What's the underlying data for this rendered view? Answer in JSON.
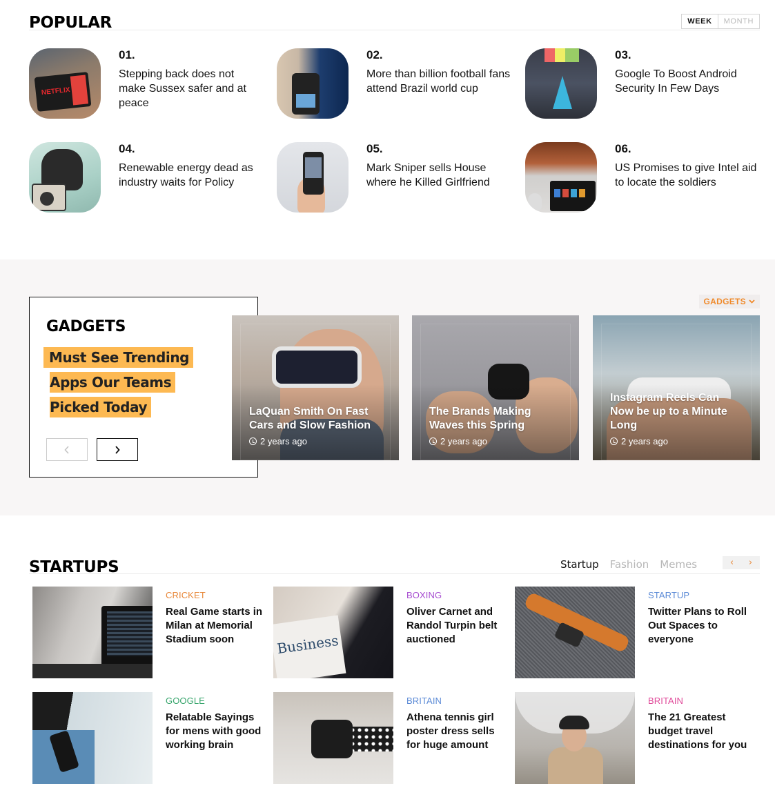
{
  "popular": {
    "title": "POPULAR",
    "period_tabs": [
      {
        "label": "WEEK",
        "active": true
      },
      {
        "label": "MONTH",
        "active": false
      }
    ],
    "items": [
      {
        "number": "01.",
        "title": "Stepping back does not make Sussex safer and at peace",
        "image": "tablet-netflix"
      },
      {
        "number": "02.",
        "title": "More than billion football fans attend Brazil world cup",
        "image": "payment-terminal"
      },
      {
        "number": "03.",
        "title": "Google To Boost Android Security In Few Days",
        "image": "blue-lamp"
      },
      {
        "number": "04.",
        "title": "Renewable energy dead as industry waits for Policy",
        "image": "radio-person"
      },
      {
        "number": "05.",
        "title": "Mark Sniper sells House where he Killed Girlfriend",
        "image": "hand-phone"
      },
      {
        "number": "06.",
        "title": "US Promises to give Intel aid to locate the soldiers",
        "image": "tv-speaker"
      }
    ]
  },
  "gadgets": {
    "title": "GADGETS",
    "highlight_lines": [
      "Must See Trending",
      "Apps Our Teams",
      "Picked Today"
    ],
    "prev_icon": "chevron-left-icon",
    "next_icon": "chevron-right-icon",
    "filter": {
      "label": "GADGETS",
      "icon": "chevron-down-icon",
      "color": "#f08a2b"
    },
    "highlight_color": "#fdb952",
    "cards": [
      {
        "title": "LaQuan Smith On Fast Cars and Slow Fashion",
        "time": "2 years ago",
        "image": "vr-headset"
      },
      {
        "title": "The Brands Making Waves this Spring",
        "time": "2 years ago",
        "image": "earbuds"
      },
      {
        "title": "Instagram Reels Can Now be up to a Minute Long",
        "time": "2 years ago",
        "image": "game-controller"
      }
    ]
  },
  "startups": {
    "title": "STARTUPS",
    "tabs": [
      {
        "label": "Startup",
        "active": true
      },
      {
        "label": "Fashion",
        "active": false
      },
      {
        "label": "Memes",
        "active": false
      }
    ],
    "arrows": {
      "prev": "‹",
      "next": "›"
    },
    "items": [
      {
        "category": "CRICKET",
        "category_color": "#e8883a",
        "title": "Real Game starts in Milan at Memorial Stadium soon",
        "image": "laptop-code"
      },
      {
        "category": "BOXING",
        "category_color": "#a64bd0",
        "title": "Oliver Carnet and Randol Turpin belt auctioned",
        "image": "business-newspaper"
      },
      {
        "category": "STARTUP",
        "category_color": "#5b8ad6",
        "title": "Twitter Plans to Roll Out Spaces to everyone",
        "image": "watch-strap"
      },
      {
        "category": "GOOGLE",
        "category_color": "#3aa66e",
        "title": "Relatable Sayings for mens with good working brain",
        "image": "phone-pocket"
      },
      {
        "category": "BRITAIN",
        "category_color": "#5b8ad6",
        "title": "Athena tennis girl poster dress sells for huge amount",
        "image": "smartwatch"
      },
      {
        "category": "BRITAIN",
        "category_color": "#e04a9a",
        "title": "The 21 Greatest budget travel destinations for you",
        "image": "umbrella-woman"
      }
    ]
  }
}
